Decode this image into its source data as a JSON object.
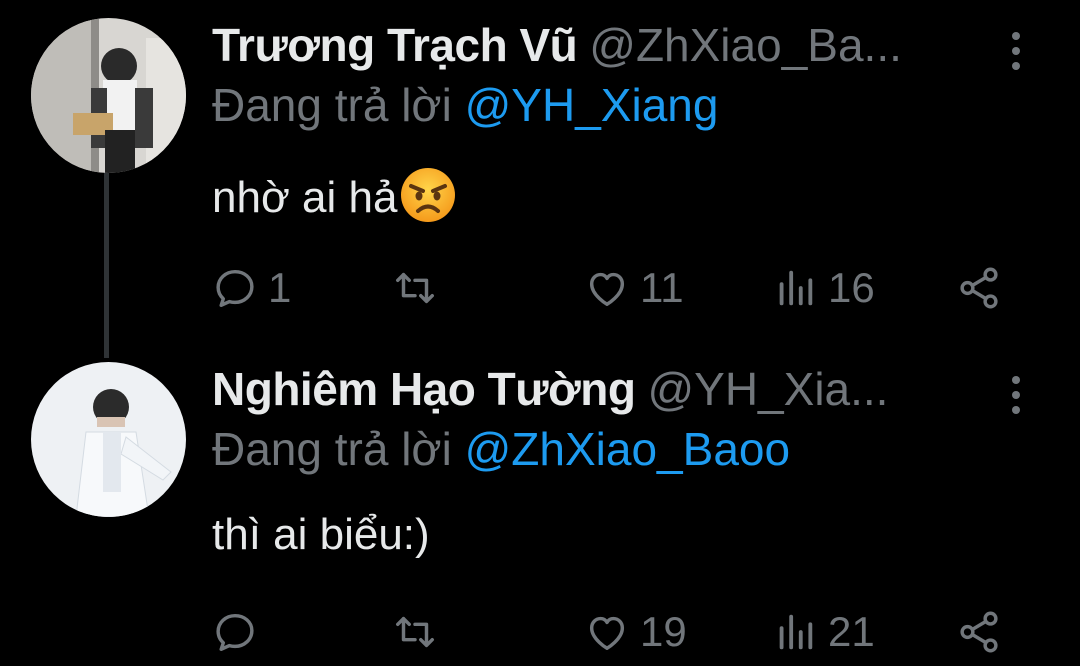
{
  "tweets": [
    {
      "name": "Trương Trạch Vũ",
      "handle": "@ZhXiao_Ba...",
      "reply_prefix": "Đang trả lời",
      "reply_mention": "@YH_Xiang",
      "text": "nhờ ai hả",
      "emoji": "angry-face-emoji",
      "replies": "1",
      "retweets": "",
      "likes": "11",
      "views": "16"
    },
    {
      "name": "Nghiêm Hạo Tường",
      "handle": "@YH_Xia...",
      "reply_prefix": "Đang trả lời",
      "reply_mention": "@ZhXiao_Baoo",
      "text": "thì ai biểu:)",
      "replies": "",
      "retweets": "",
      "likes": "19",
      "views": "21"
    }
  ],
  "colors": {
    "background": "#000000",
    "name": "#e7e9ea",
    "secondary": "#71767b",
    "mention": "#1d9bf0",
    "thread_line": "#2f3336"
  },
  "icons": [
    "reply-icon",
    "retweet-icon",
    "like-icon",
    "views-icon",
    "share-icon",
    "more-options-icon"
  ]
}
